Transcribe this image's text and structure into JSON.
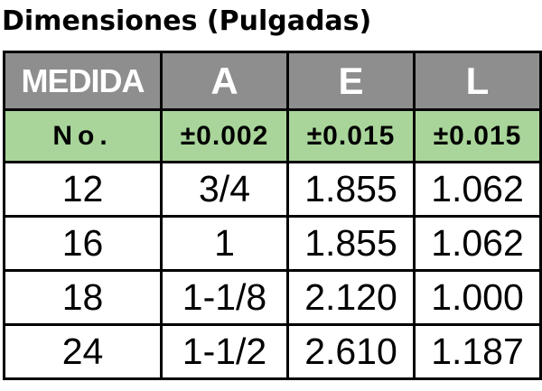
{
  "title": "Dimensiones (Pulgadas)",
  "table": {
    "headers": [
      "MEDIDA",
      "A",
      "E",
      "L"
    ],
    "subheaders": [
      "No.",
      "±0.002",
      "±0.015",
      "±0.015"
    ],
    "rows": [
      [
        "12",
        "3/4",
        "1.855",
        "1.062"
      ],
      [
        "16",
        "1",
        "1.855",
        "1.062"
      ],
      [
        "18",
        "1-1/8",
        "2.120",
        "1.000"
      ],
      [
        "24",
        "1-1/2",
        "2.610",
        "1.187"
      ]
    ]
  },
  "colors": {
    "header_bg": "#8e8e8e",
    "subheader_bg": "#a9d59a",
    "border": "#000000"
  }
}
